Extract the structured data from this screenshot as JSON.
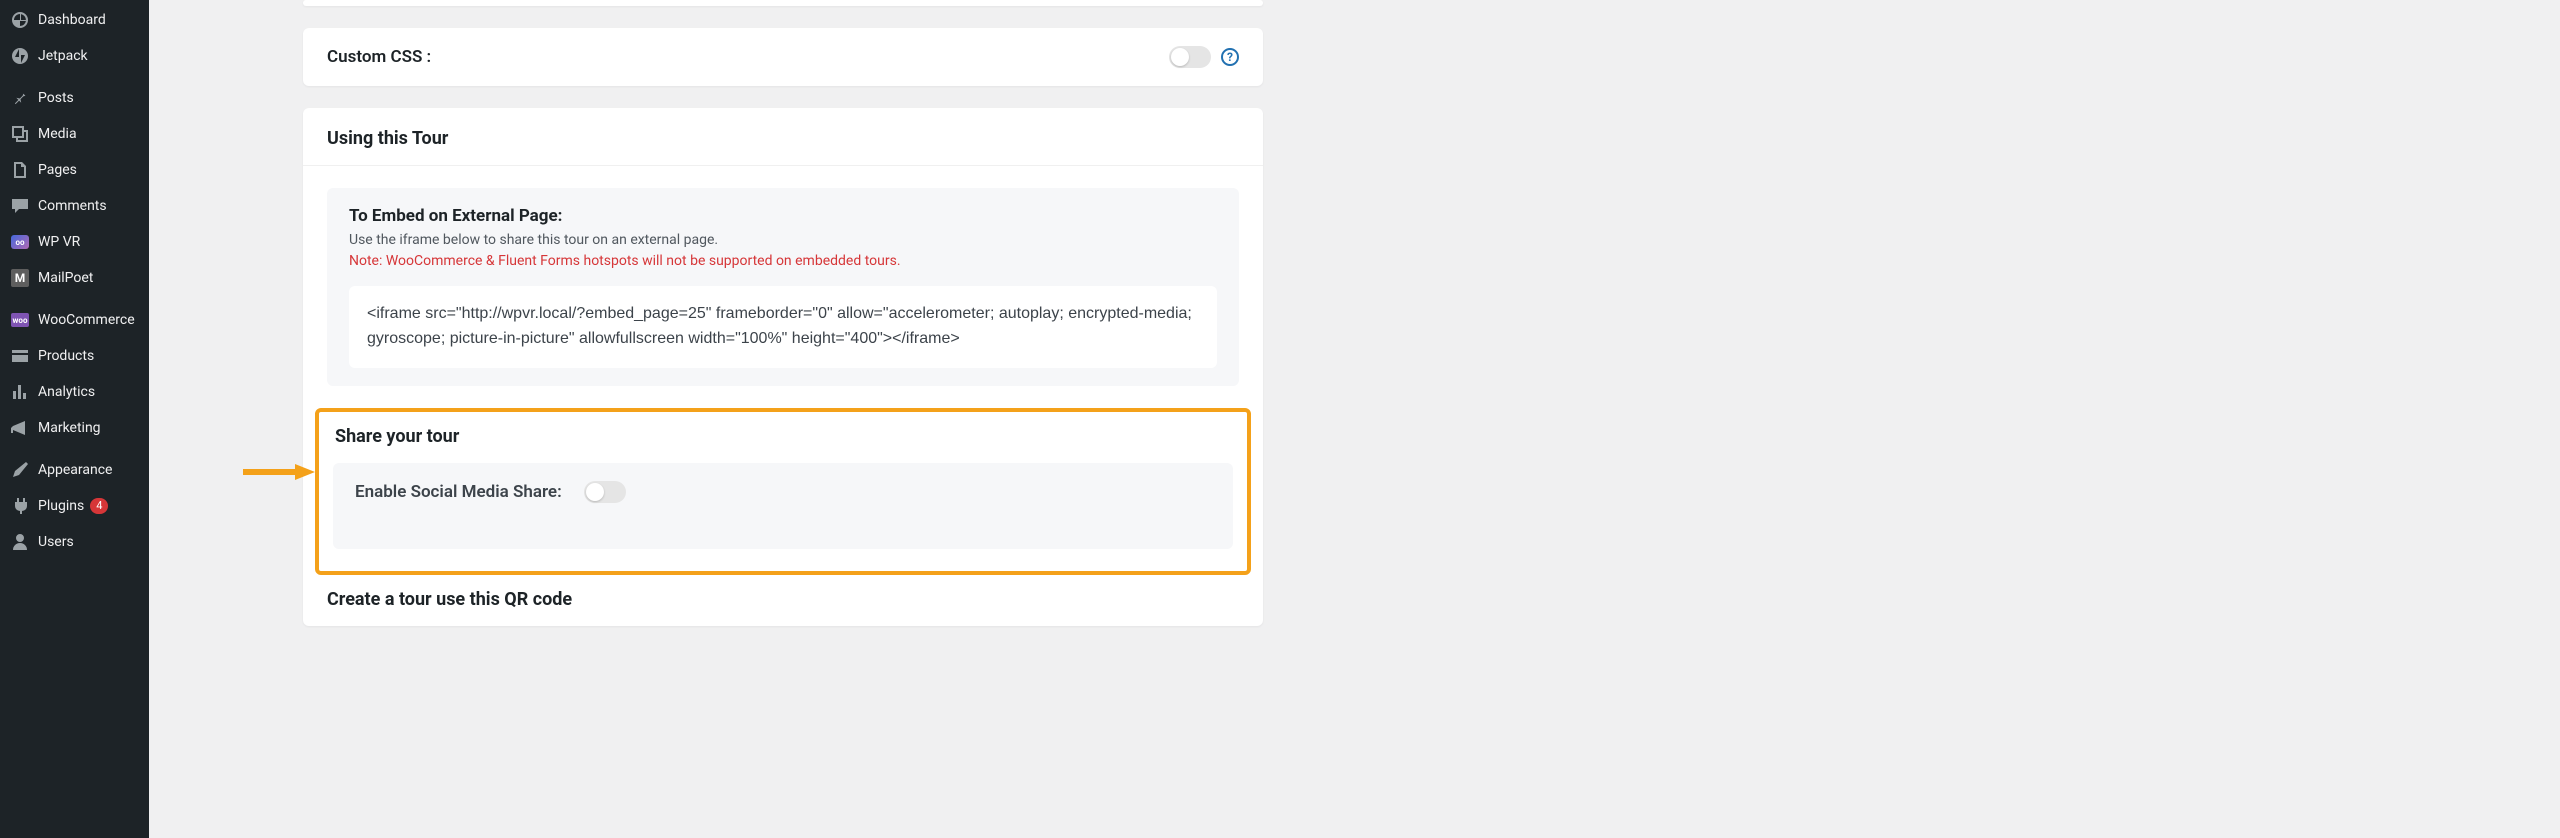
{
  "sidebar": {
    "items": [
      {
        "label": "Dashboard"
      },
      {
        "label": "Jetpack"
      },
      {
        "label": "Posts"
      },
      {
        "label": "Media"
      },
      {
        "label": "Pages"
      },
      {
        "label": "Comments"
      },
      {
        "label": "WP VR"
      },
      {
        "label": "MailPoet",
        "letter": "M"
      },
      {
        "label": "WooCommerce"
      },
      {
        "label": "Products"
      },
      {
        "label": "Analytics"
      },
      {
        "label": "Marketing"
      },
      {
        "label": "Appearance"
      },
      {
        "label": "Plugins",
        "badge": "4"
      },
      {
        "label": "Users"
      }
    ]
  },
  "settings": {
    "custom_css_label": "Custom CSS :"
  },
  "using_tour": {
    "header": "Using this Tour",
    "embed_title": "To Embed on External Page:",
    "embed_desc": "Use the iframe below to share this tour on an external page.",
    "embed_note": "Note: WooCommerce & Fluent Forms hotspots will not be supported on embedded tours.",
    "iframe_code": "<iframe src=\"http://wpvr.local/?embed_page=25\" frameborder=\"0\" allow=\"accelerometer; autoplay; encrypted-media; gyroscope; picture-in-picture\" allowfullscreen width=\"100%\" height=\"400\"></iframe>"
  },
  "share": {
    "header": "Share your tour",
    "enable_label": "Enable Social Media Share:"
  },
  "qr": {
    "header": "Create a tour use this QR code"
  }
}
